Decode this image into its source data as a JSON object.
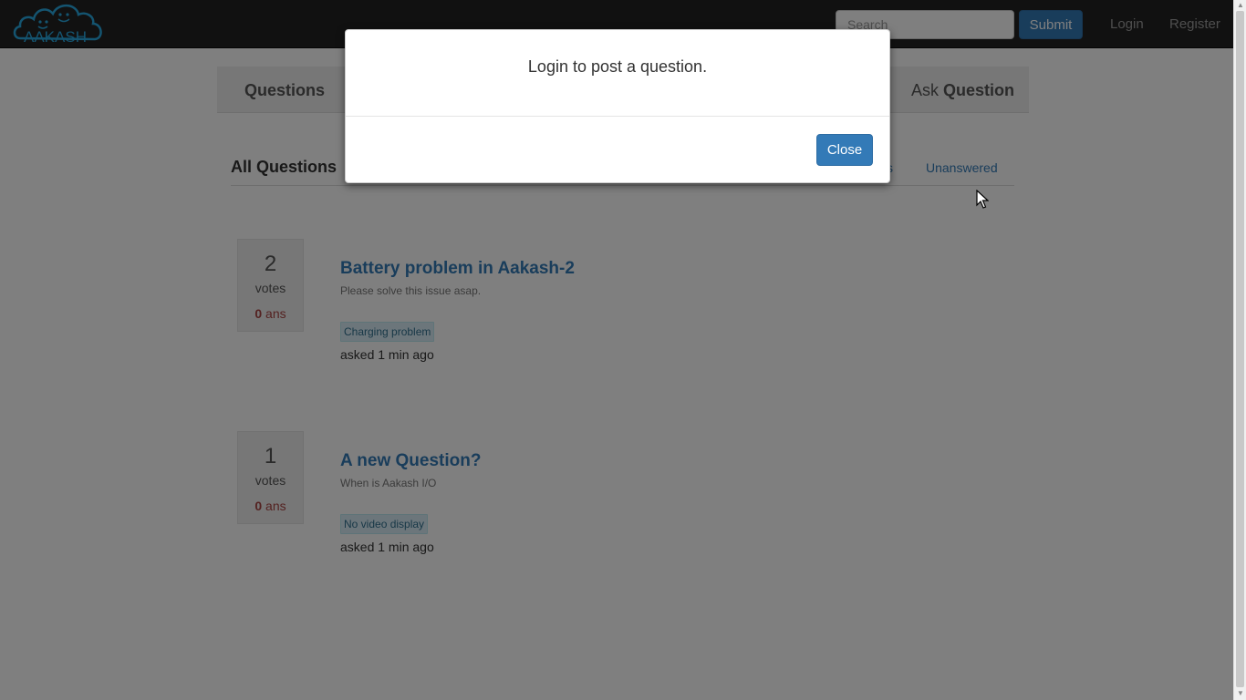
{
  "navbar": {
    "logo_text": "AAKASH",
    "search_placeholder": "Search",
    "submit_label": "Submit",
    "login_label": "Login",
    "register_label": "Register"
  },
  "subnav": {
    "questions_label": "Questions",
    "ask_prefix": "Ask",
    "ask_bold": "Question"
  },
  "section": {
    "title": "All Questions",
    "filters": [
      "s",
      "Unanswered"
    ]
  },
  "questions": [
    {
      "votes": "2",
      "votes_label": "votes",
      "answers": "0",
      "answers_label": "ans",
      "title": "Battery problem in Aakash-2",
      "excerpt": "Please solve this issue asap.",
      "tag": "Charging problem",
      "asked": "asked 1 min ago"
    },
    {
      "votes": "1",
      "votes_label": "votes",
      "answers": "0",
      "answers_label": "ans",
      "title": "A new Question?",
      "excerpt": "When is Aakash I/O",
      "tag": "No video display",
      "asked": "asked 1 min ago"
    }
  ],
  "modal": {
    "message": "Login to post a question.",
    "close_label": "Close"
  },
  "colors": {
    "navbar_bg": "#222222",
    "primary": "#337ab7",
    "answers_red": "#a94442",
    "logo_blue": "#29a8e0"
  }
}
